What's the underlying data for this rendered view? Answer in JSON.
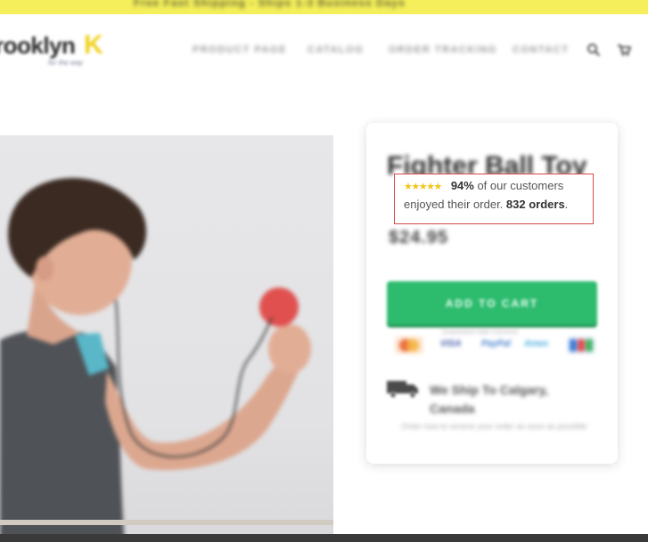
{
  "announcement": {
    "text": "Free Fast Shipping - Ships 1-3 Business Days"
  },
  "brand": {
    "wordmark": "rooklyn",
    "mark": "K",
    "tagline": "for the way"
  },
  "nav": {
    "items": [
      {
        "label": "PRODUCT PAGE"
      },
      {
        "label": "CATALOG"
      },
      {
        "label": "ORDER TRACKING"
      },
      {
        "label": "CONTACT"
      }
    ],
    "search_icon": "search-icon",
    "cart_icon": "cart-icon"
  },
  "product": {
    "title": "Fighter Ball Toy",
    "review": {
      "stars_icon": "star-rating-icon",
      "rating_stars": 5,
      "percent": "94%",
      "text1": " of our customers",
      "text2": "enjoyed their order. ",
      "orders": "832 orders",
      "period": "."
    },
    "price": "$24.95",
    "add_to_cart_label": "ADD TO CART",
    "secure_text": "Guaranteed Safe Checkout",
    "payments": [
      "MasterCard",
      "VISA",
      "PayPal",
      "Amex",
      "JCB"
    ],
    "shipping": {
      "icon": "truck-icon",
      "title": "We Ship To Calgary, Canada",
      "subtitle": "Order now to receive your order as soon as possible"
    }
  },
  "colors": {
    "announcement_bg": "#f4ef5a",
    "accent_green": "#2dbb6e",
    "highlight_border": "#d44a4a",
    "star": "#f3c51c"
  }
}
